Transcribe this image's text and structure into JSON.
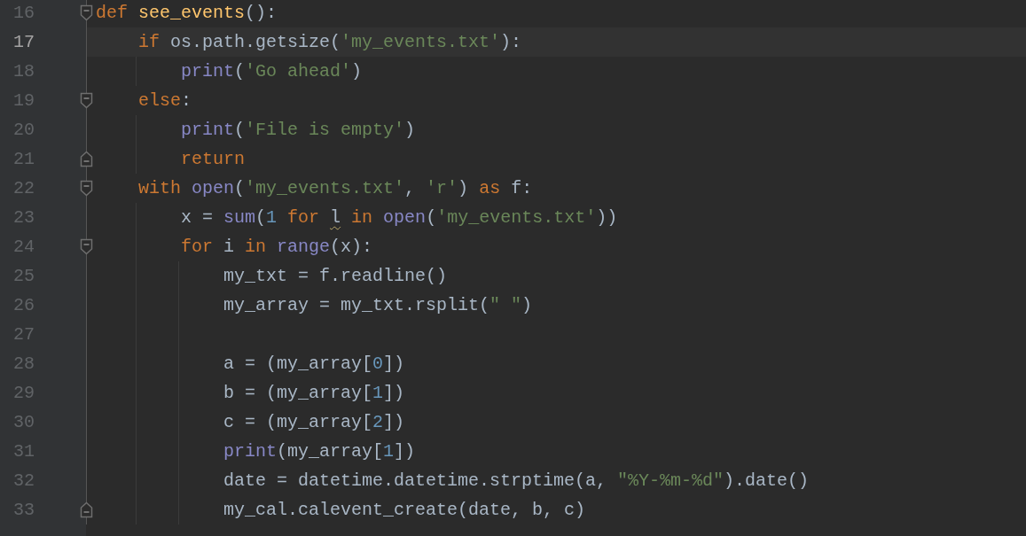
{
  "editor": {
    "lines": [
      {
        "number": "16",
        "current": false,
        "fold": {
          "kind": "start"
        },
        "tokens": [
          {
            "kind": "keyword",
            "text": "def "
          },
          {
            "kind": "defname",
            "text": "see_events"
          },
          {
            "kind": "plain",
            "text": "():"
          }
        ],
        "children": [
          {
            "number": "17",
            "current": true,
            "tokens": [
              {
                "kind": "keyword",
                "text": "if "
              },
              {
                "kind": "plain",
                "text": "os.path.getsize("
              },
              {
                "kind": "string",
                "text": "'my_events.txt'"
              },
              {
                "kind": "plain",
                "text": "):"
              }
            ],
            "children": [
              {
                "number": "18",
                "current": false,
                "tokens": [
                  {
                    "kind": "builtin",
                    "text": "print"
                  },
                  {
                    "kind": "plain",
                    "text": "("
                  },
                  {
                    "kind": "string",
                    "text": "'Go ahead'"
                  },
                  {
                    "kind": "plain",
                    "text": ")"
                  }
                ]
              }
            ]
          },
          {
            "number": "19",
            "current": false,
            "fold": {
              "kind": "start"
            },
            "tokens": [
              {
                "kind": "keyword",
                "text": "else"
              },
              {
                "kind": "plain",
                "text": ":"
              }
            ],
            "children": [
              {
                "number": "20",
                "current": false,
                "tokens": [
                  {
                    "kind": "builtin",
                    "text": "print"
                  },
                  {
                    "kind": "plain",
                    "text": "("
                  },
                  {
                    "kind": "string",
                    "text": "'File is empty'"
                  },
                  {
                    "kind": "plain",
                    "text": ")"
                  }
                ]
              },
              {
                "number": "21",
                "current": false,
                "fold": {
                  "kind": "end"
                },
                "tokens": [
                  {
                    "kind": "keyword",
                    "text": "return"
                  }
                ]
              }
            ]
          },
          {
            "number": "22",
            "current": false,
            "fold": {
              "kind": "start"
            },
            "tokens": [
              {
                "kind": "keyword",
                "text": "with "
              },
              {
                "kind": "builtin",
                "text": "open"
              },
              {
                "kind": "plain",
                "text": "("
              },
              {
                "kind": "string",
                "text": "'my_events.txt'"
              },
              {
                "kind": "plain",
                "text": ", "
              },
              {
                "kind": "string",
                "text": "'r'"
              },
              {
                "kind": "plain",
                "text": ") "
              },
              {
                "kind": "keyword",
                "text": "as "
              },
              {
                "kind": "plain",
                "text": "f:"
              }
            ],
            "children": [
              {
                "number": "23",
                "current": false,
                "tokens": [
                  {
                    "kind": "plain",
                    "text": "x = "
                  },
                  {
                    "kind": "builtin",
                    "text": "sum"
                  },
                  {
                    "kind": "plain",
                    "text": "("
                  },
                  {
                    "kind": "number",
                    "text": "1 "
                  },
                  {
                    "kind": "keyword",
                    "text": "for "
                  },
                  {
                    "kind": "warning",
                    "text": "l"
                  },
                  {
                    "kind": "keyword",
                    "text": " in "
                  },
                  {
                    "kind": "builtin",
                    "text": "open"
                  },
                  {
                    "kind": "plain",
                    "text": "("
                  },
                  {
                    "kind": "string",
                    "text": "'my_events.txt'"
                  },
                  {
                    "kind": "plain",
                    "text": "))"
                  }
                ]
              },
              {
                "number": "24",
                "current": false,
                "fold": {
                  "kind": "start"
                },
                "tokens": [
                  {
                    "kind": "keyword",
                    "text": "for "
                  },
                  {
                    "kind": "plain",
                    "text": "i "
                  },
                  {
                    "kind": "keyword",
                    "text": "in "
                  },
                  {
                    "kind": "builtin",
                    "text": "range"
                  },
                  {
                    "kind": "plain",
                    "text": "(x):"
                  }
                ],
                "children": [
                  {
                    "number": "25",
                    "current": false,
                    "tokens": [
                      {
                        "kind": "plain",
                        "text": "my_txt = f.readline()"
                      }
                    ]
                  },
                  {
                    "number": "26",
                    "current": false,
                    "tokens": [
                      {
                        "kind": "plain",
                        "text": "my_array = my_txt.rsplit("
                      },
                      {
                        "kind": "string",
                        "text": "\" \""
                      },
                      {
                        "kind": "plain",
                        "text": ")"
                      }
                    ]
                  },
                  {
                    "number": "27",
                    "current": false
                  },
                  {
                    "number": "28",
                    "current": false,
                    "tokens": [
                      {
                        "kind": "plain",
                        "text": "a = (my_array["
                      },
                      {
                        "kind": "number",
                        "text": "0"
                      },
                      {
                        "kind": "plain",
                        "text": "])"
                      }
                    ]
                  },
                  {
                    "number": "29",
                    "current": false,
                    "tokens": [
                      {
                        "kind": "plain",
                        "text": "b = (my_array["
                      },
                      {
                        "kind": "number",
                        "text": "1"
                      },
                      {
                        "kind": "plain",
                        "text": "])"
                      }
                    ]
                  },
                  {
                    "number": "30",
                    "current": false,
                    "tokens": [
                      {
                        "kind": "plain",
                        "text": "c = (my_array["
                      },
                      {
                        "kind": "number",
                        "text": "2"
                      },
                      {
                        "kind": "plain",
                        "text": "])"
                      }
                    ]
                  },
                  {
                    "number": "31",
                    "current": false,
                    "tokens": [
                      {
                        "kind": "builtin",
                        "text": "print"
                      },
                      {
                        "kind": "plain",
                        "text": "(my_array["
                      },
                      {
                        "kind": "number",
                        "text": "1"
                      },
                      {
                        "kind": "plain",
                        "text": "])"
                      }
                    ]
                  },
                  {
                    "number": "32",
                    "current": false,
                    "tokens": [
                      {
                        "kind": "plain",
                        "text": "date = datetime.datetime.strptime(a, "
                      },
                      {
                        "kind": "string",
                        "text": "\"%Y-%m-%d\""
                      },
                      {
                        "kind": "plain",
                        "text": ").date()"
                      }
                    ]
                  },
                  {
                    "number": "33",
                    "current": false,
                    "fold": {
                      "kind": "end"
                    },
                    "tokens": [
                      {
                        "kind": "plain",
                        "text": "my_cal.calevent_create(date, b, c)"
                      }
                    ]
                  }
                ]
              }
            ]
          }
        ]
      }
    ]
  }
}
